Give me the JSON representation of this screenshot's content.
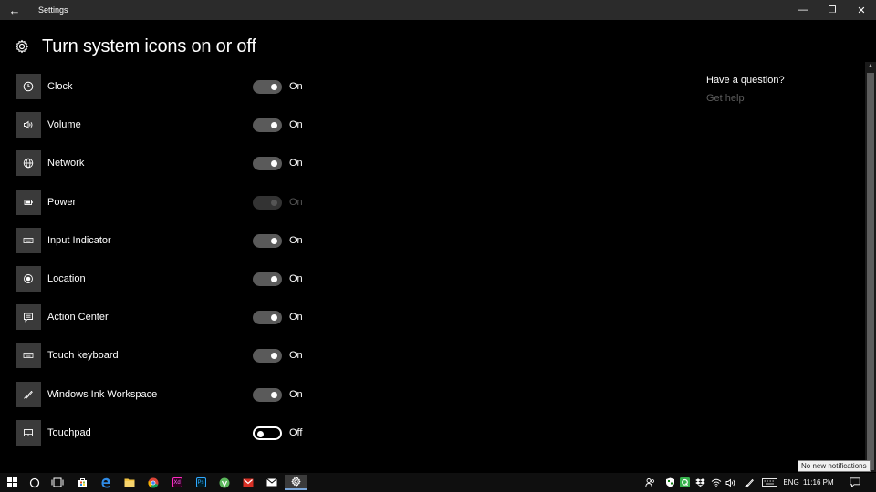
{
  "window": {
    "title": "Settings",
    "back_glyph": "←",
    "minimize_glyph": "—",
    "restore_glyph": "❐",
    "close_glyph": "✕"
  },
  "page": {
    "title": "Turn system icons on or off",
    "icon": "gear-icon"
  },
  "rows": [
    {
      "label": "Clock",
      "state": "On",
      "icon": "clock-icon"
    },
    {
      "label": "Volume",
      "state": "On",
      "icon": "volume-icon"
    },
    {
      "label": "Network",
      "state": "On",
      "icon": "network-icon"
    },
    {
      "label": "Power",
      "state": "On",
      "icon": "battery-icon",
      "disabled": true
    },
    {
      "label": "Input Indicator",
      "state": "On",
      "icon": "keyboard-icon"
    },
    {
      "label": "Location",
      "state": "On",
      "icon": "location-icon"
    },
    {
      "label": "Action Center",
      "state": "On",
      "icon": "action-center-icon"
    },
    {
      "label": "Touch keyboard",
      "state": "On",
      "icon": "touch-keyboard-icon"
    },
    {
      "label": "Windows Ink Workspace",
      "state": "On",
      "icon": "pen-icon"
    },
    {
      "label": "Touchpad",
      "state": "Off",
      "icon": "touchpad-icon"
    }
  ],
  "help": {
    "question": "Have a question?",
    "link": "Get help"
  },
  "tooltip": "No new notifications",
  "taskbar": {
    "apps": [
      "start-icon",
      "search-icon",
      "task-view-icon",
      "store-icon",
      "edge-icon",
      "file-explorer-icon",
      "chrome-icon",
      "xd-icon",
      "photoshop-icon",
      "app-green-icon",
      "gmail-icon",
      "mail-icon",
      "settings-icon"
    ],
    "xd_label": "Xd",
    "ps_label": "Ps",
    "language": "ENG",
    "time": "11:16 PM"
  },
  "colors": {
    "background": "#000000",
    "titlebar": "#2b2b2b",
    "icon_tile": "#3a3a3a",
    "toggle_on_track": "#5a5a5a",
    "link_disabled": "#5c5c5c",
    "taskbar_accent": "#7aa6d8"
  }
}
